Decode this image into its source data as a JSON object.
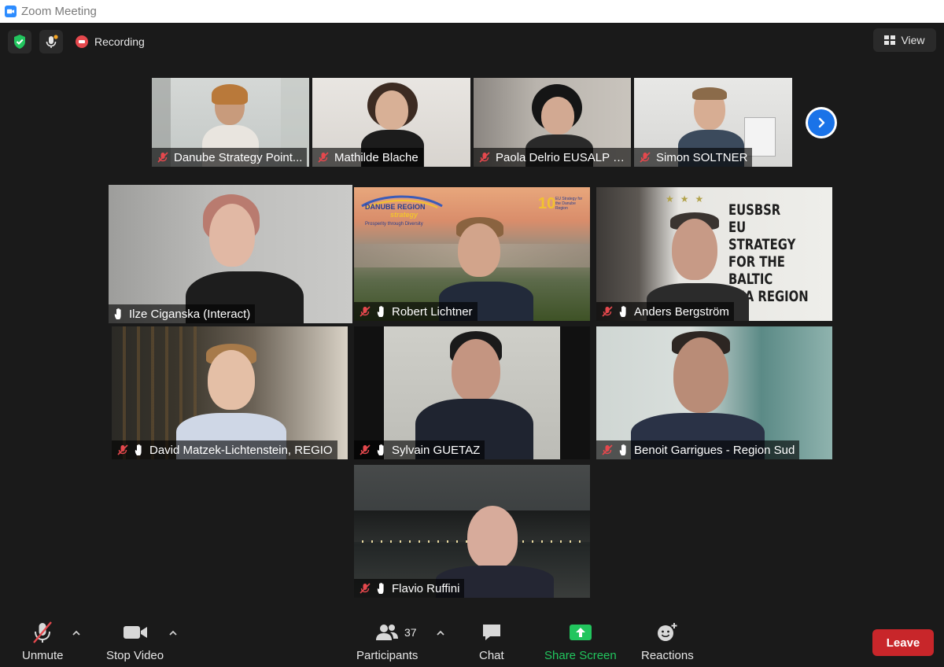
{
  "window": {
    "title": "Zoom Meeting"
  },
  "status": {
    "recording_label": "Recording"
  },
  "header": {
    "view_label": "View"
  },
  "strip_tiles": [
    {
      "name": "Danube Strategy Point..."
    },
    {
      "name": "Mathilde Blache"
    },
    {
      "name": "Paola Delrio EUSALP It..."
    },
    {
      "name": "Simon SOLTNER"
    }
  ],
  "gallery_tiles": [
    {
      "name": "Ilze Ciganska (Interact)"
    },
    {
      "name": "Robert Lichtner"
    },
    {
      "name": "Anders Bergström"
    },
    {
      "name": "David Matzek-Lichtenstein, REGIO"
    },
    {
      "name": "Sylvain GUETAZ"
    },
    {
      "name": "Benoit Garrigues - Region Sud"
    },
    {
      "name": "Flavio Ruffini"
    }
  ],
  "backgrounds": {
    "danube_title": "DANUBE REGION",
    "danube_sub": "strategy",
    "danube_tagline": "Prosperity through Diversity",
    "danube_years": "10",
    "danube_right": "EU Strategy for the Danube Region",
    "eusbsr_line1": "EUSBSR",
    "eusbsr_line2": "EU STRATEGY",
    "eusbsr_line3": "FOR THE BALTIC",
    "eusbsr_line4": "SEA REGION"
  },
  "toolbar": {
    "unmute": "Unmute",
    "stop_video": "Stop Video",
    "participants": "Participants",
    "participants_count": "37",
    "chat": "Chat",
    "share_screen": "Share Screen",
    "reactions": "Reactions",
    "leave": "Leave"
  },
  "colors": {
    "accent_blue": "#2d8cff",
    "active_speaker": "#c8e06a",
    "share_green": "#22c55e",
    "leave_red": "#c8262a",
    "mute_red": "#e5484d"
  }
}
